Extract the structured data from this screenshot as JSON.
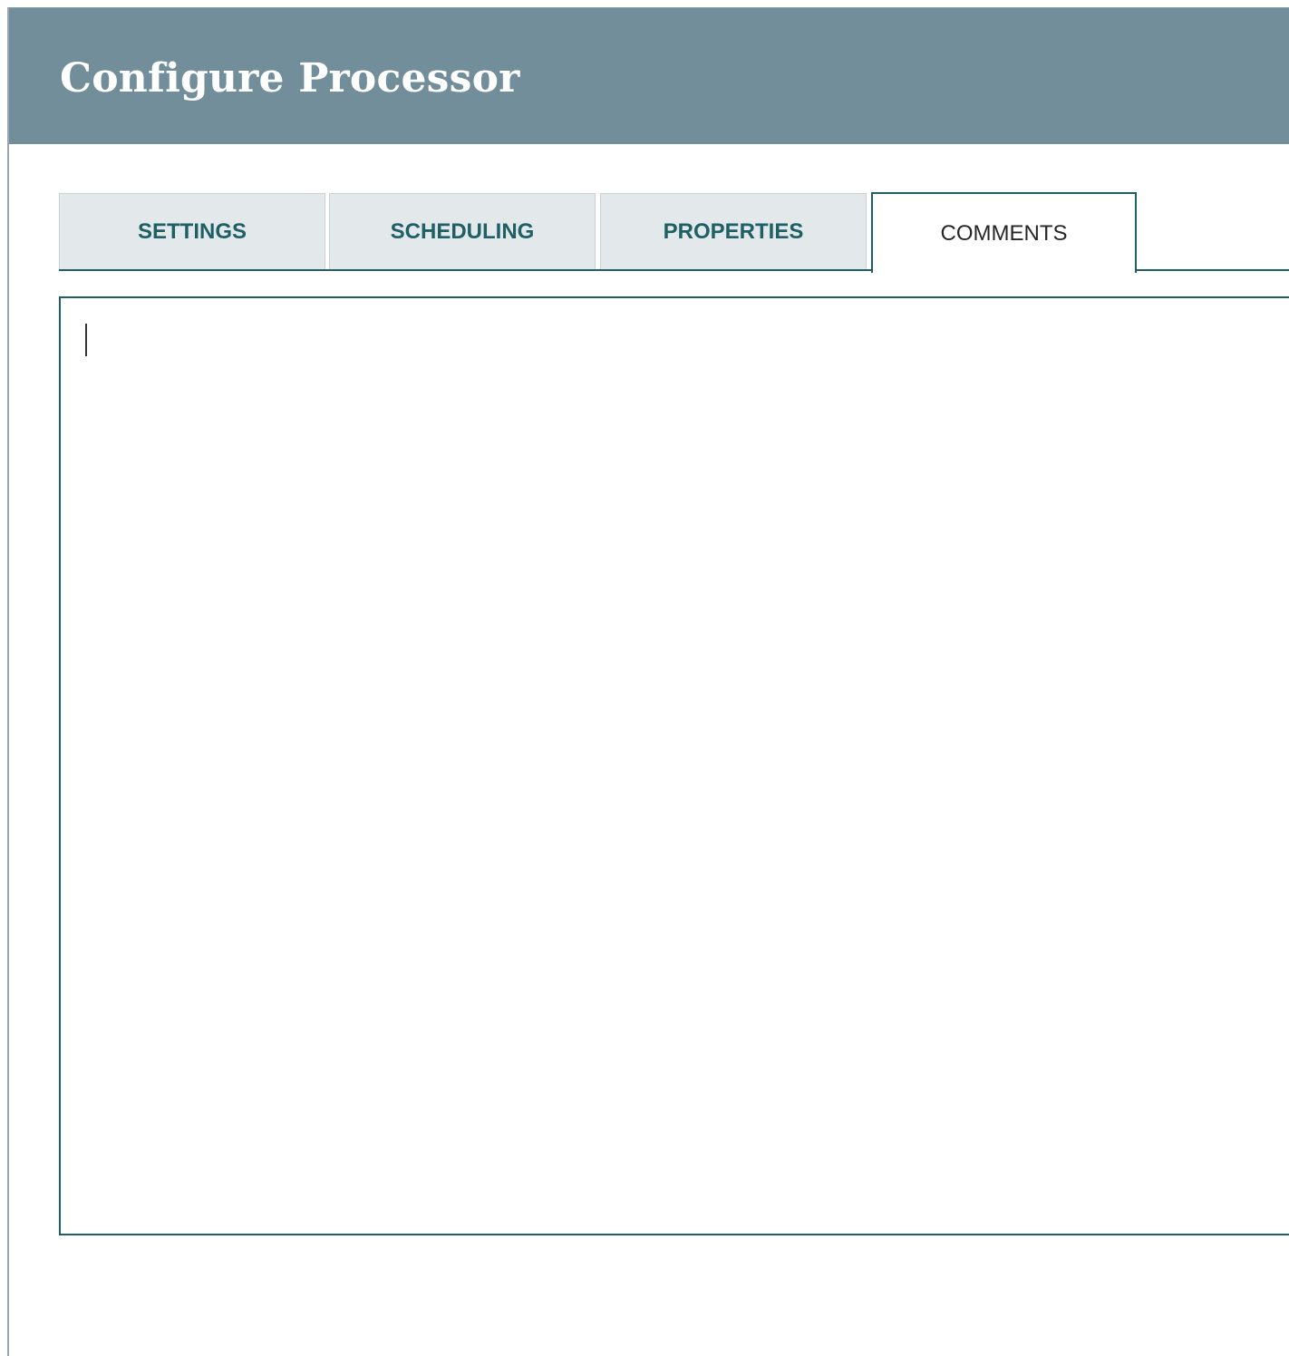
{
  "dialog": {
    "title": "Configure Processor"
  },
  "tabs": [
    {
      "label": "SETTINGS",
      "active": false
    },
    {
      "label": "SCHEDULING",
      "active": false
    },
    {
      "label": "PROPERTIES",
      "active": false
    },
    {
      "label": "COMMENTS",
      "active": true
    }
  ],
  "comments": {
    "value": ""
  },
  "colors": {
    "header_bg": "#728e9b",
    "accent": "#1f6067",
    "tab_inactive_bg": "#e3e8eb"
  }
}
